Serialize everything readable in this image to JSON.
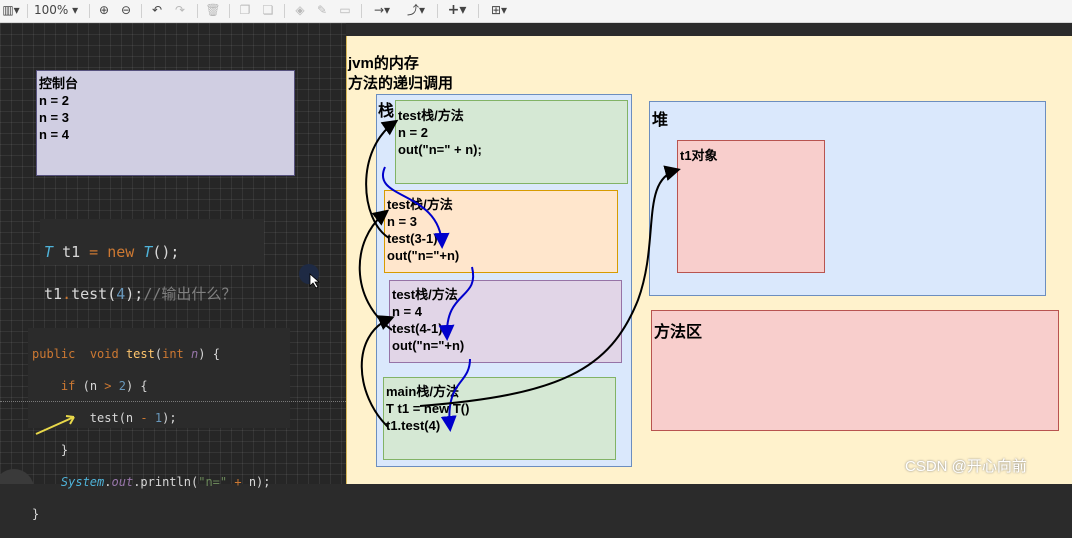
{
  "toolbar": {
    "zoom": "100%",
    "icons": [
      "panel-toggle-icon",
      "zoom-in-icon",
      "zoom-out-icon",
      "undo-icon",
      "redo-icon",
      "delete-icon",
      "to-front-icon",
      "to-back-icon",
      "fill-color-icon",
      "line-color-icon",
      "shadow-icon",
      "connection-icon",
      "waypoints-icon",
      "insert-icon",
      "table-icon"
    ]
  },
  "console": {
    "title": "控制台",
    "lines": [
      "n = 2",
      "n = 3",
      "n = 4"
    ]
  },
  "snippet1": {
    "type": "T",
    "var": "t1",
    "eq": "=",
    "new": "new",
    "ctor": "T",
    "tail": "();",
    "call_var": "t1",
    "dot": ".",
    "call": "test(",
    "arg": "4",
    "close": ");",
    "comment": "//输出什么？"
  },
  "snippet2": {
    "l1_mod": "public",
    "l1_void": "void",
    "l1_name": "test",
    "l1_open": "(",
    "l1_type": "int",
    "l1_param": "n",
    "l1_close": ") {",
    "l2_if": "if",
    "l2_a": "(n",
    "l2_op": ">",
    "l2_num": "2",
    "l2_b": ") {",
    "l3_a": "test(n",
    "l3_op": "-",
    "l3_num": "1",
    "l3_b": ");",
    "l4": "}",
    "l5_cls": "System",
    "l5_a": ".",
    "l5_out": "out",
    "l5_b": ".println(",
    "l5_str": "\"n=\"",
    "l5_op": "+",
    "l5_c": "n);",
    "l6": "}"
  },
  "diagram": {
    "title1": "jvm的内存",
    "title2": "方法的递归调用",
    "stack_label": "栈",
    "heap_label": "堆",
    "method_area_label": "方法区",
    "object_label": "t1对象",
    "frames": [
      {
        "lines": [
          "test栈/方法",
          "n = 2",
          "out(\"n=\" + n);"
        ]
      },
      {
        "lines": [
          "test栈/方法",
          "n = 3",
          "test(3-1)",
          "out(\"n=\"+n)"
        ]
      },
      {
        "lines": [
          "test栈/方法",
          "n = 4",
          "test(4-1)",
          "out(\"n=\"+n)"
        ]
      },
      {
        "lines": [
          "main栈/方法",
          "T t1 = new T()",
          "t1.test(4)"
        ]
      }
    ]
  },
  "watermark": "CSDN @开心向前",
  "colors": {
    "frame_green": "#d5e8d4",
    "frame_orange": "#ffe6cc",
    "frame_purple": "#e1d5e7",
    "stack_bg": "#dae8fc",
    "object_red": "#f8cecc",
    "arrow_blue": "#0000cc"
  }
}
